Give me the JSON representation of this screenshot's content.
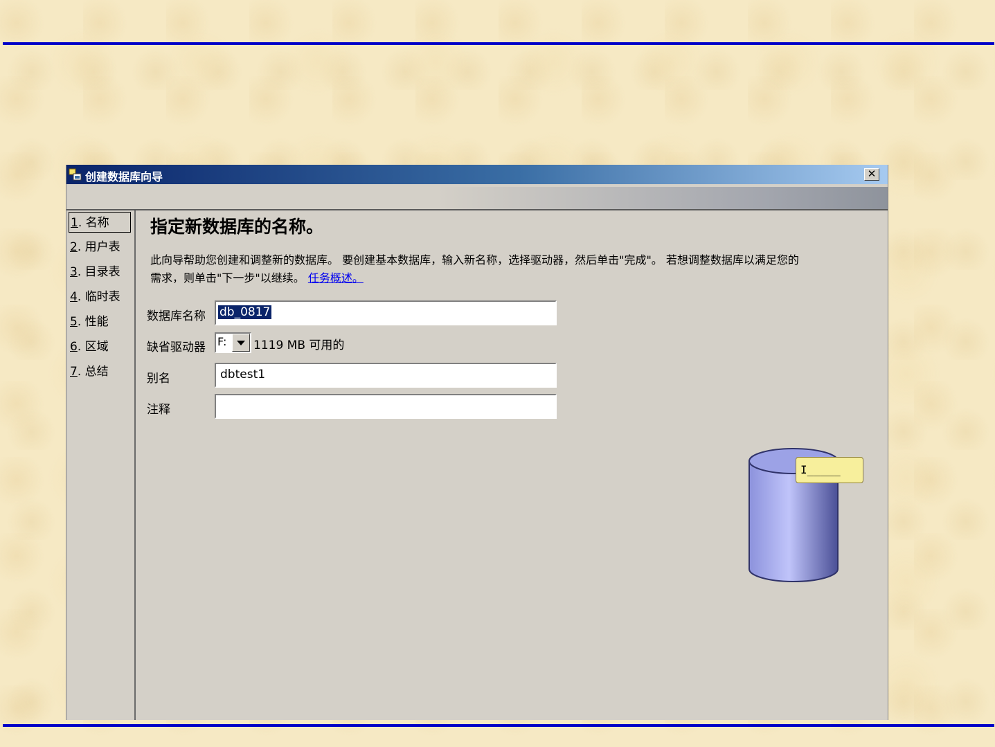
{
  "window": {
    "title": "创建数据库向导",
    "close_label": "✕"
  },
  "sidebar": {
    "items": [
      {
        "num": "1",
        "label": ". 名称",
        "active": true
      },
      {
        "num": "2",
        "label": ". 用户表"
      },
      {
        "num": "3",
        "label": ". 目录表"
      },
      {
        "num": "4",
        "label": ". 临时表"
      },
      {
        "num": "5",
        "label": ". 性能"
      },
      {
        "num": "6",
        "label": ". 区域"
      },
      {
        "num": "7",
        "label": ". 总结"
      }
    ]
  },
  "main": {
    "heading": "指定新数据库的名称。",
    "description_line1": "此向导帮助您创建和调整新的数据库。 要创建基本数据库，输入新名称，选择驱动器，然后单击\"完成\"。 若想调整数据库以满足您的",
    "description_line2": "需求，则单击\"下一步\"以继续。",
    "link_text": "任务概述。"
  },
  "form": {
    "db_name_label": "数据库名称",
    "db_name_value": "db_0817",
    "drive_label": "缺省驱动器",
    "drive_value": "F:",
    "drive_space": "1119 MB 可用的",
    "alias_label": "别名",
    "alias_value": "dbtest1",
    "comment_label": "注释",
    "comment_value": ""
  },
  "illustration": {
    "tooltip_text": "I_____",
    "cylinder_color": "#aab0ee"
  }
}
